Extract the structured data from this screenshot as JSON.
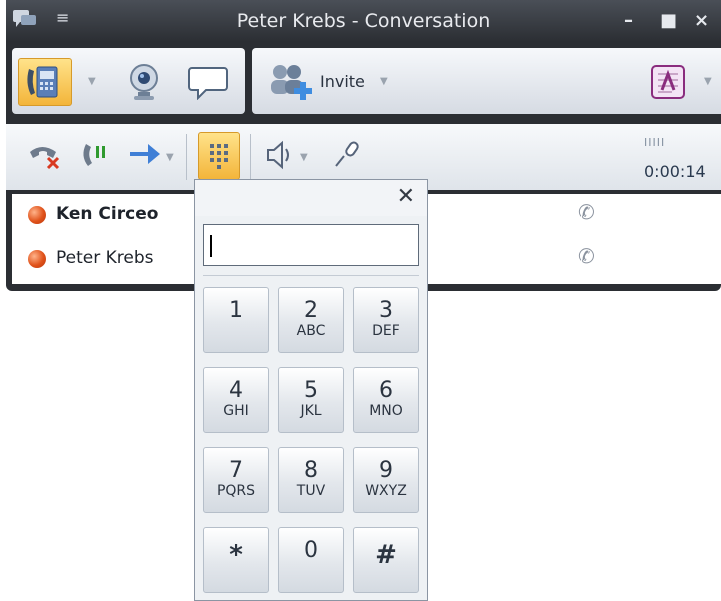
{
  "window": {
    "title": "Peter Krebs - Conversation",
    "controls": {
      "minimize": "–",
      "maximize": "■",
      "close": "×"
    }
  },
  "toolbar1": {
    "invite_label": "Invite",
    "icons": [
      "phone-call-icon",
      "webcam-icon",
      "im-bubble-icon",
      "invite-people-icon",
      "onenote-icon"
    ]
  },
  "toolbar2": {
    "icons": [
      "hang-up-icon",
      "hold-icon",
      "transfer-icon",
      "dial-pad-icon",
      "speaker-icon",
      "microphone-icon"
    ],
    "signal_bars": "IIIII",
    "call_timer": "0:00:14"
  },
  "participants": [
    {
      "name": "Ken Circeo",
      "status_color": "#e0521a",
      "bold": true
    },
    {
      "name": "Peter Krebs",
      "status_color": "#e0521a",
      "bold": false
    }
  ],
  "dialpad": {
    "close_label": "✕",
    "input_value": "",
    "keys": [
      {
        "digit": "1",
        "letters": ""
      },
      {
        "digit": "2",
        "letters": "ABC"
      },
      {
        "digit": "3",
        "letters": "DEF"
      },
      {
        "digit": "4",
        "letters": "GHI"
      },
      {
        "digit": "5",
        "letters": "JKL"
      },
      {
        "digit": "6",
        "letters": "MNO"
      },
      {
        "digit": "7",
        "letters": "PQRS"
      },
      {
        "digit": "8",
        "letters": "TUV"
      },
      {
        "digit": "9",
        "letters": "WXYZ"
      },
      {
        "digit": "*",
        "letters": ""
      },
      {
        "digit": "0",
        "letters": ""
      },
      {
        "digit": "#",
        "letters": ""
      }
    ]
  },
  "colors": {
    "accent": "#f3b53a",
    "frame": "#2b2e33",
    "status_busy": "#e0521a"
  }
}
